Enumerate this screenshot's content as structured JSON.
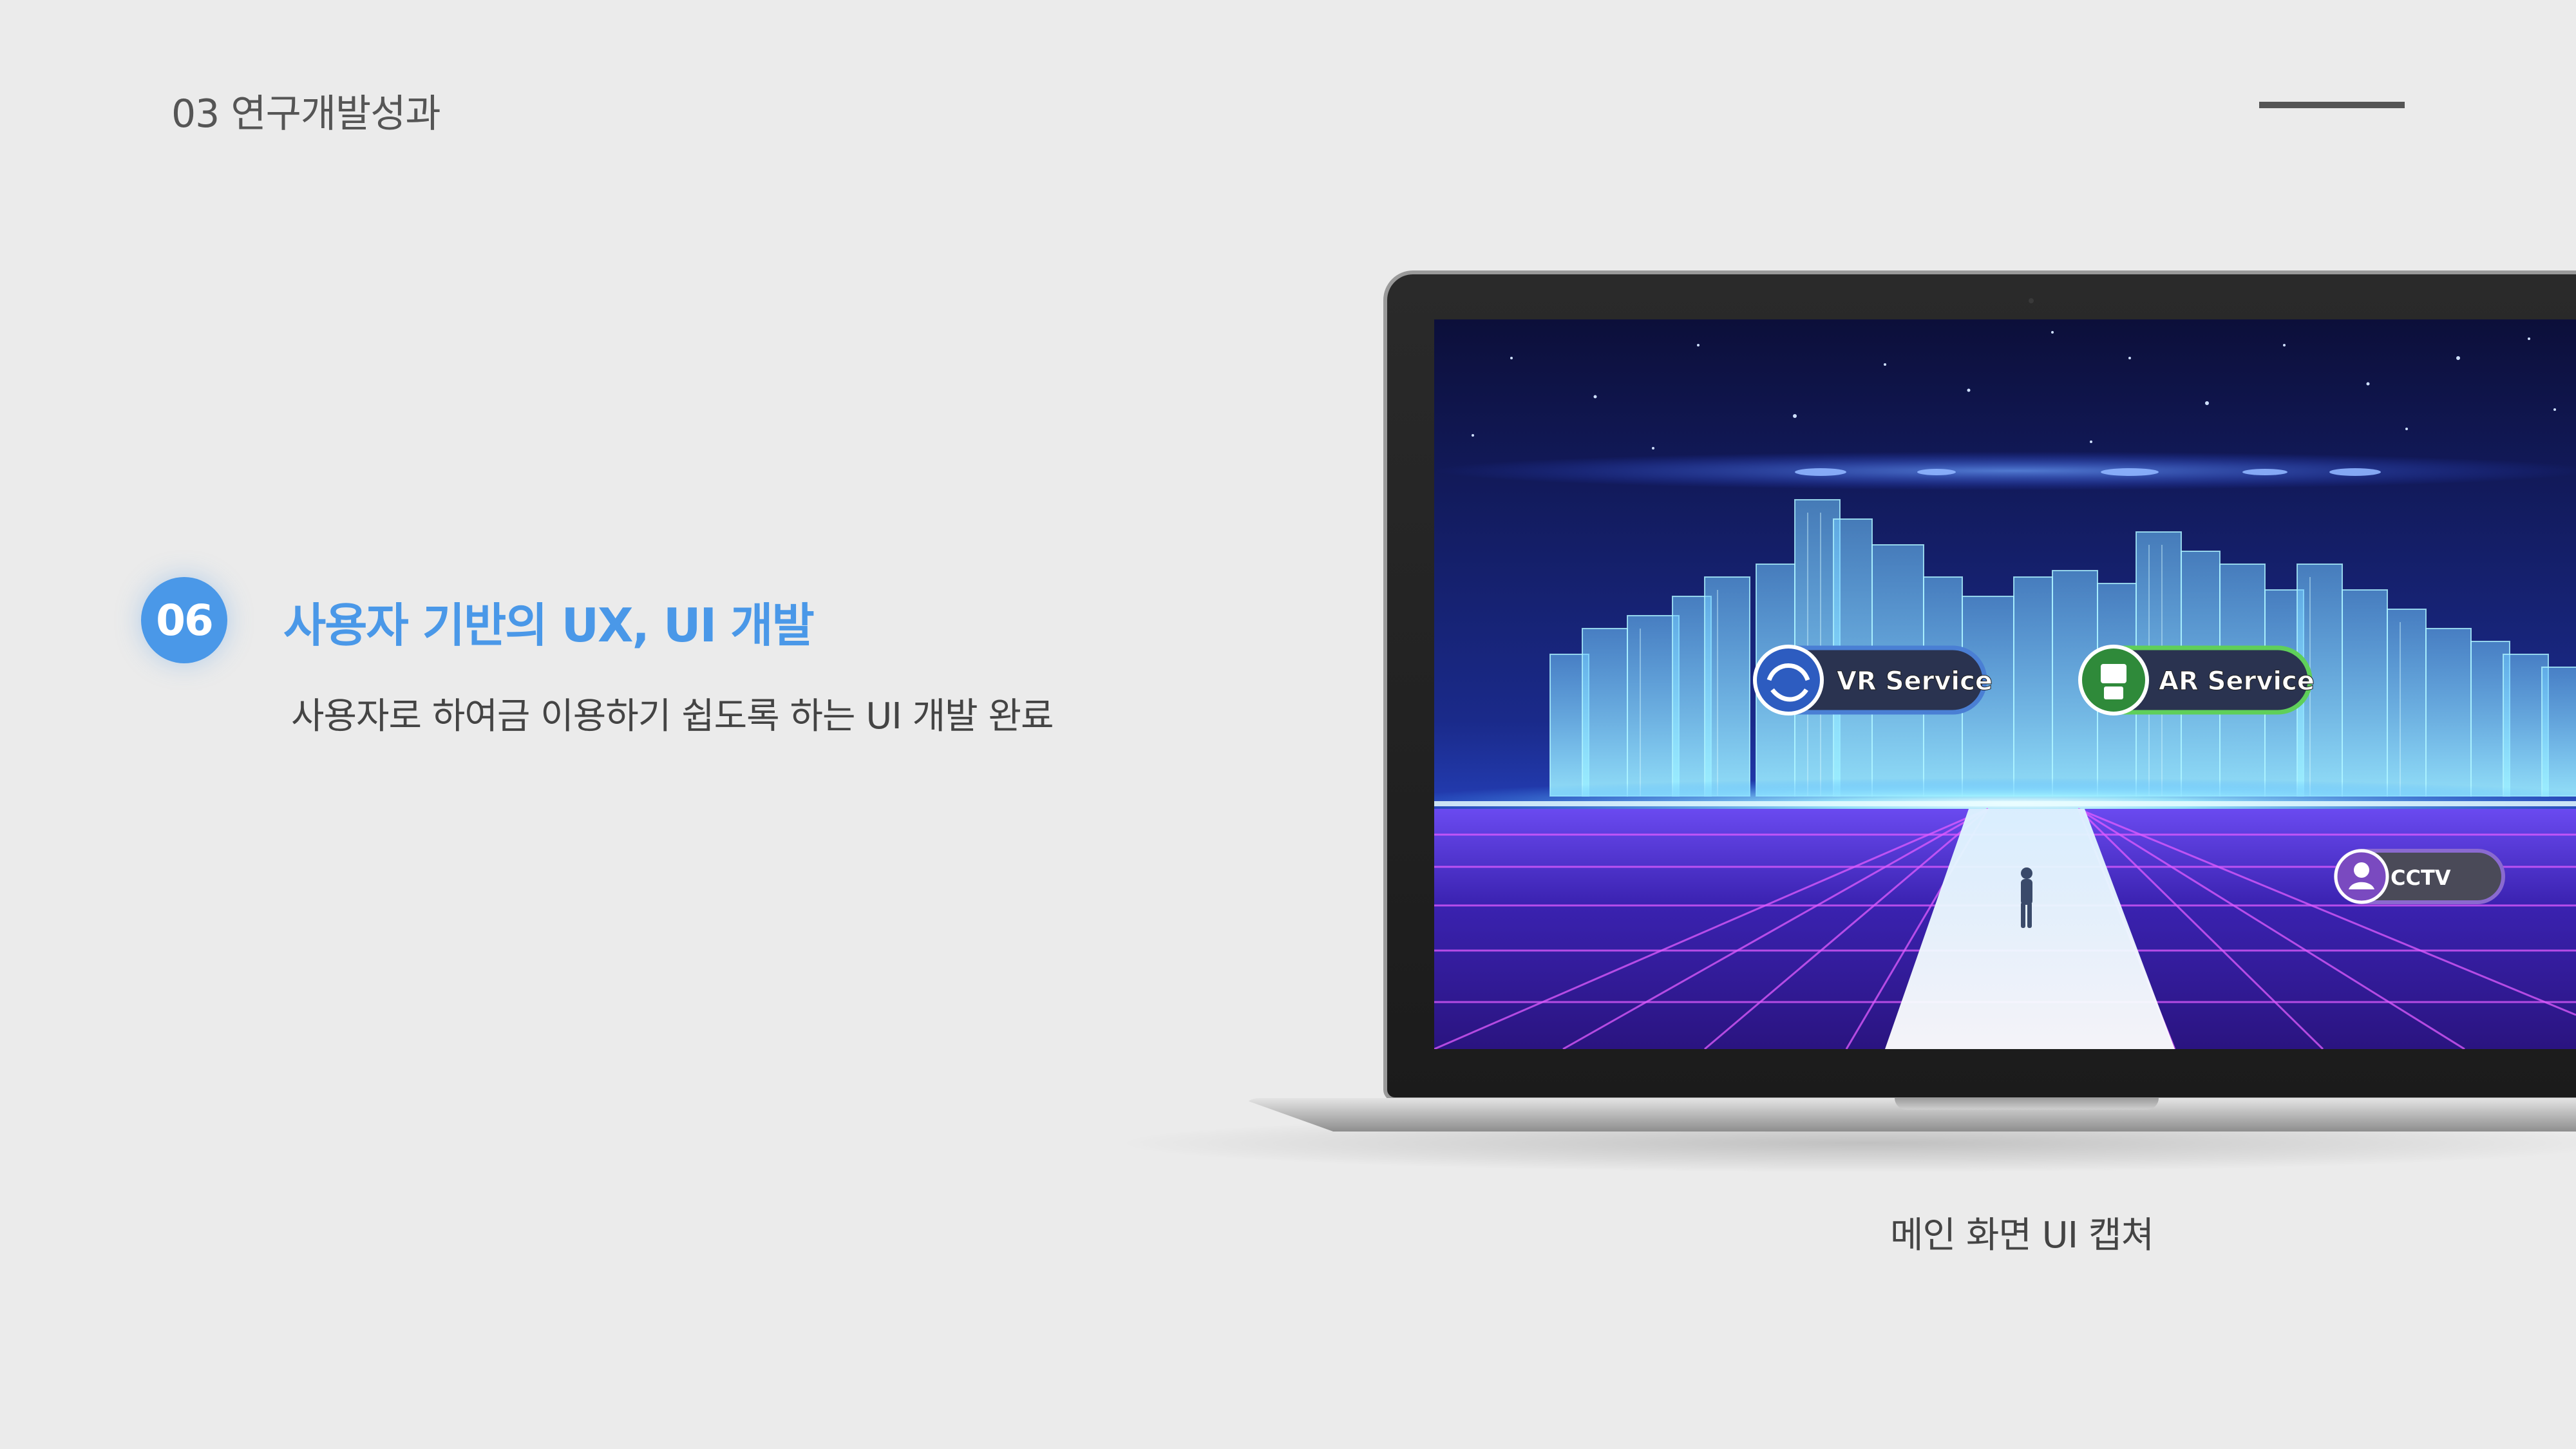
{
  "header": {
    "section_label": "03 연구개발성과"
  },
  "item": {
    "number": "06",
    "title": "사용자 기반의 UX, UI 개발",
    "description": "사용자로 하여금 이용하기 쉽도록 하는 UI 개발 완료"
  },
  "screenshot": {
    "caption": "메인 화면 UI 캡쳐",
    "buttons": {
      "vr": "VR Service",
      "ar": "AR Service",
      "third": "CCTV"
    }
  },
  "colors": {
    "accent": "#4a98e8",
    "background": "#ebebeb",
    "text": "#444444",
    "vr_button_border": "#4a7fd4",
    "ar_button_border": "#5fcf5a",
    "third_button_border": "#8a6ad0"
  },
  "icons": {
    "vr": "vr-headset-icon",
    "ar": "robot-icon",
    "third": "person-icon"
  }
}
